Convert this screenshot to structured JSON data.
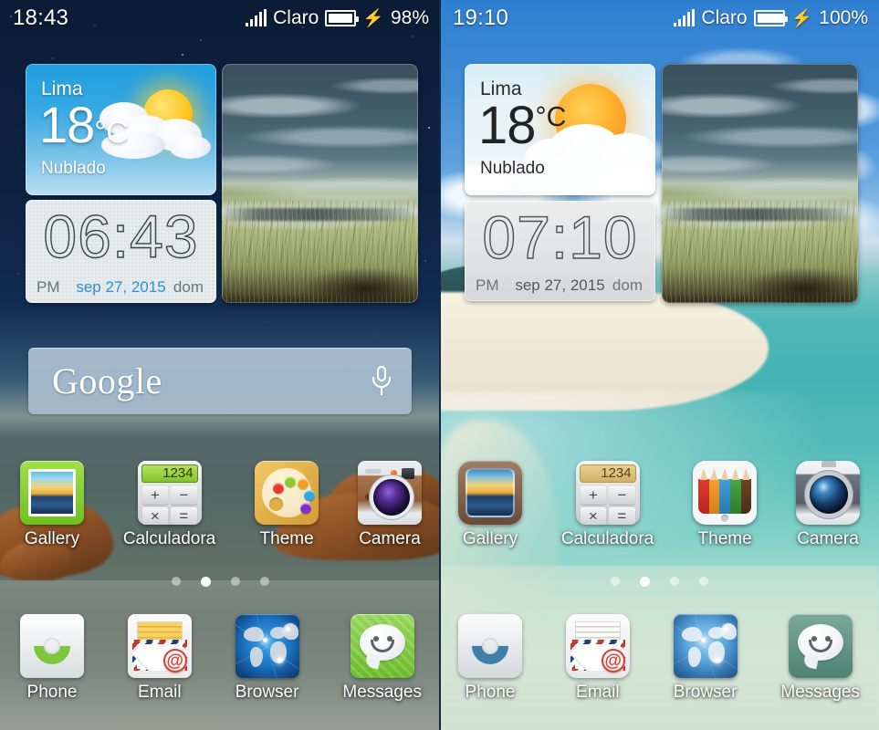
{
  "screens": [
    {
      "id": "screen-left",
      "theme_name": "dark-theme",
      "status_bar": {
        "clock": "18:43",
        "carrier": "Claro",
        "battery_percent": "98%",
        "charging_icon": "bolt-icon",
        "signal_icon": "signal-bars-icon",
        "battery_icon": "battery-icon"
      },
      "weather_widget": {
        "city": "Lima",
        "temperature": "18",
        "unit": "°C",
        "condition": "Nublado",
        "icon": "sun-behind-cloud-icon"
      },
      "clock_widget": {
        "time": "06:43",
        "ampm": "PM",
        "date": "sep 27, 2015",
        "day_of_week": "dom",
        "date_color": "#2f8fd4"
      },
      "photo_widget": {
        "name": "photo-frame-widget",
        "description": "field landscape under cloudy sky"
      },
      "search_bar": {
        "logo_text": "Google",
        "placeholder": "Google",
        "mic_icon": "microphone-icon"
      },
      "page_indicator": {
        "total": 4,
        "active": 2
      },
      "app_row": [
        {
          "label": "Gallery",
          "icon": "gallery-icon"
        },
        {
          "label": "Calculadora",
          "icon": "calculator-icon",
          "display": "1234"
        },
        {
          "label": "Theme",
          "icon": "palette-icon"
        },
        {
          "label": "Camera",
          "icon": "camera-icon"
        }
      ],
      "dock_row": [
        {
          "label": "Phone",
          "icon": "phone-handset-icon"
        },
        {
          "label": "Email",
          "icon": "envelope-at-icon",
          "badge_glyph": "@"
        },
        {
          "label": "Browser",
          "icon": "globe-icon"
        },
        {
          "label": "Messages",
          "icon": "smiley-chat-bubble-icon"
        }
      ],
      "calc_keys": [
        "+",
        "−",
        "×",
        "="
      ]
    },
    {
      "id": "screen-right",
      "theme_name": "light-theme",
      "status_bar": {
        "clock": "19:10",
        "carrier": "Claro",
        "battery_percent": "100%",
        "charging_icon": "bolt-icon",
        "signal_icon": "signal-bars-icon",
        "battery_icon": "battery-icon"
      },
      "weather_widget": {
        "city": "Lima",
        "temperature": "18",
        "unit": "°C",
        "condition": "Nublado",
        "icon": "sun-behind-cloud-icon"
      },
      "clock_widget": {
        "time": "07:10",
        "ampm": "PM",
        "date": "sep 27, 2015",
        "day_of_week": "dom",
        "date_color": "#55595c"
      },
      "photo_widget": {
        "name": "photo-frame-widget",
        "description": "field landscape under cloudy sky"
      },
      "page_indicator": {
        "total": 4,
        "active": 2
      },
      "app_row": [
        {
          "label": "Gallery",
          "icon": "gallery-icon"
        },
        {
          "label": "Calculadora",
          "icon": "calculator-icon",
          "display": "1234"
        },
        {
          "label": "Theme",
          "icon": "colored-pencils-icon"
        },
        {
          "label": "Camera",
          "icon": "camera-icon"
        }
      ],
      "dock_row": [
        {
          "label": "Phone",
          "icon": "phone-handset-icon"
        },
        {
          "label": "Email",
          "icon": "envelope-at-icon",
          "badge_glyph": "@"
        },
        {
          "label": "Browser",
          "icon": "globe-icon"
        },
        {
          "label": "Messages",
          "icon": "smiley-chat-bubble-icon"
        }
      ],
      "calc_keys": [
        "+",
        "−",
        "×",
        "="
      ]
    }
  ],
  "colors": {
    "status_text": "#ffffff",
    "label_text": "#ffffff",
    "left_wallpaper_top": "#0c1c36",
    "right_wallpaper_top": "#2f7fd1",
    "right_water": "#45b3b2",
    "weather_dark_bg": "#37a8e2",
    "weather_light_bg": "#e8f3f8",
    "clock_stroke": "#3c4347"
  }
}
